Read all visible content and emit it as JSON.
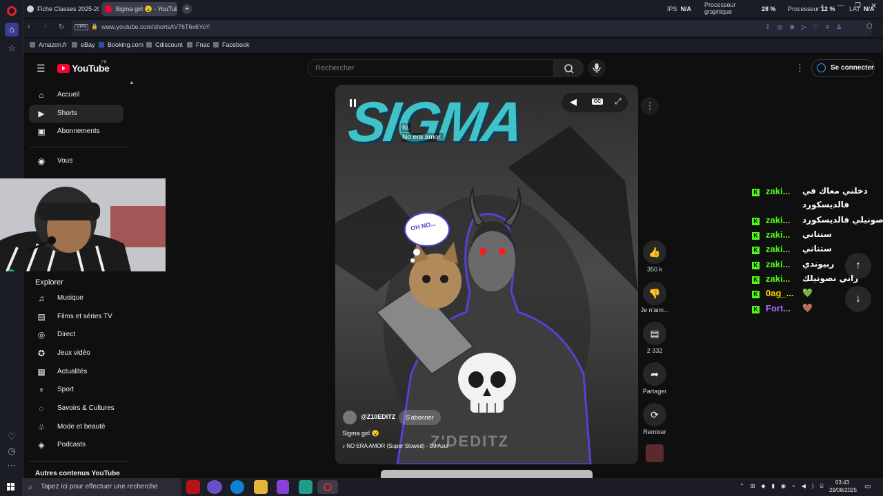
{
  "tabs": [
    {
      "title": "Fiche Classes 2025-2026",
      "active": false
    },
    {
      "title": "Sigma girl 😮 - YouTube",
      "active": true
    }
  ],
  "stats": {
    "ips_label": "IPS",
    "ips_value": "N/A",
    "gpu_label_1": "Processeur",
    "gpu_label_2": "graphique",
    "gpu_value": "28 %",
    "cpu_label": "Processeur",
    "cpu_value": "12 %",
    "lat_label": "LAT",
    "lat_value": "N/A"
  },
  "address": {
    "vpn": "VPN",
    "url": "www.youtube.com/shorts/tV76T6x6YoY"
  },
  "bookmarks": [
    "Amazon.fr",
    "eBay",
    "Booking.com",
    "Cdiscount",
    "Fnac",
    "Facebook"
  ],
  "youtube": {
    "logo": "YouTube",
    "region": "FR",
    "search_placeholder": "Rechercher",
    "signin": "Se connecter",
    "nav": [
      {
        "label": "Accueil",
        "icon": "home-icon"
      },
      {
        "label": "Shorts",
        "icon": "shorts-icon"
      },
      {
        "label": "Abonnements",
        "icon": "subscriptions-icon"
      },
      {
        "label": "Vous",
        "icon": "you-icon"
      }
    ],
    "explore_title": "Explorer",
    "explore": [
      {
        "label": "Musique",
        "icon": "music-icon"
      },
      {
        "label": "Films et séries TV",
        "icon": "film-icon"
      },
      {
        "label": "Direct",
        "icon": "live-icon"
      },
      {
        "label": "Jeux vidéo",
        "icon": "gaming-icon"
      },
      {
        "label": "Actualités",
        "icon": "news-icon"
      },
      {
        "label": "Sport",
        "icon": "sport-icon"
      },
      {
        "label": "Savoirs & Cultures",
        "icon": "learning-icon"
      },
      {
        "label": "Mode et beauté",
        "icon": "fashion-icon"
      },
      {
        "label": "Podcasts",
        "icon": "podcast-icon"
      }
    ],
    "more_title": "Autres contenus YouTube"
  },
  "short": {
    "title_overlay": "SIGMA",
    "caption_line1": "tú.",
    "caption_line2": "No era amor.",
    "bubble": "OH NO...",
    "watermark": "Z'DEDITZ",
    "channel": "@Z10EDITZ",
    "subscribe": "S'abonner",
    "video_title": "Sigma girl 😮",
    "music": "NO ERA AMOR (Super Slowed) - DJ Asul",
    "likes": "350 k",
    "dislike_label": "Je n'aim...",
    "comments": "2 332",
    "share_label": "Partager",
    "remix_label": "Remixer"
  },
  "chat": [
    {
      "name": "zaki...",
      "msg": "دخلني معاك في",
      "msg2": "فالديسكورد",
      "color": "#53fc18"
    },
    {
      "name": "zaki...",
      "msg": "صونيلي فالديسكورد",
      "color": "#53fc18"
    },
    {
      "name": "zaki...",
      "msg": "ستناني",
      "color": "#53fc18"
    },
    {
      "name": "zaki...",
      "msg": "ستناني",
      "color": "#53fc18"
    },
    {
      "name": "zaki...",
      "msg": "ربيوندي",
      "color": "#53fc18"
    },
    {
      "name": "zaki...",
      "msg": "راني نصونيلك",
      "color": "#53fc18"
    },
    {
      "name": "0ag_...",
      "msg": "💚",
      "color": "#ffd400"
    },
    {
      "name": "Fort...",
      "msg": "🤎",
      "color": "#b06bff"
    }
  ],
  "taskbar": {
    "search_placeholder": "Tapez ici pour effectuer une recherche",
    "time": "03:43",
    "date": "29/08/2025"
  }
}
